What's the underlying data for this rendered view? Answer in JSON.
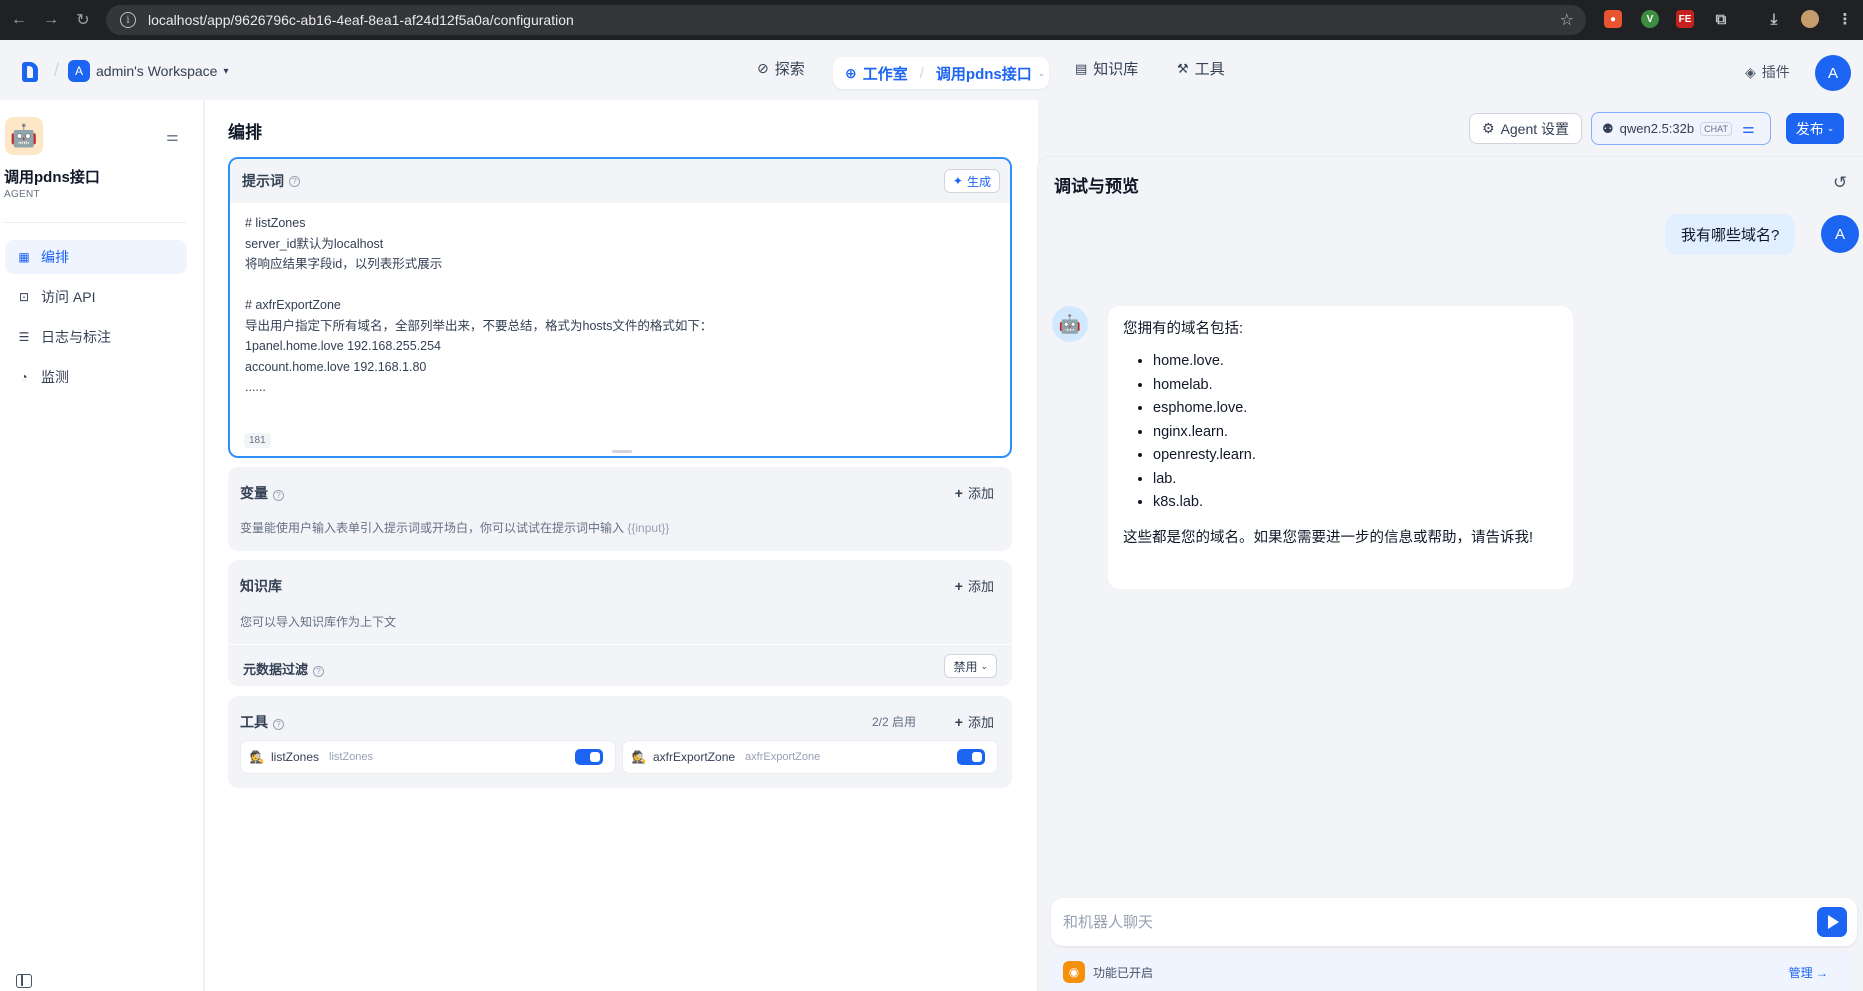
{
  "browser": {
    "url": "localhost/app/9626796c-ab16-4eaf-8ea1-af24d12f5a0a/configuration"
  },
  "header": {
    "workspace_initial": "A",
    "workspace_name": "admin's Workspace",
    "nav_explore": "探索",
    "nav_studio": "工作室",
    "nav_current_app": "调用pdns接口",
    "nav_knowledge": "知识库",
    "nav_tools": "工具",
    "plugins": "插件",
    "user_initial": "A"
  },
  "sidebar": {
    "app_name": "调用pdns接口",
    "app_type": "AGENT",
    "items": [
      {
        "label": "编排"
      },
      {
        "label": "访问 API"
      },
      {
        "label": "日志与标注"
      },
      {
        "label": "监测"
      }
    ]
  },
  "main": {
    "title": "编排",
    "prompt": {
      "title": "提示词",
      "generate_label": "生成",
      "lines": [
        "# listZones",
        "server_id默认为localhost",
        "将响应结果字段id，以列表形式展示",
        "",
        "# axfrExportZone",
        "导出用户指定下所有域名，全部列举出来，不要总结，格式为hosts文件的格式如下：",
        "1panel.home.love 192.168.255.254",
        "account.home.love 192.168.1.80",
        "......"
      ],
      "char_count": "181"
    },
    "variables": {
      "title": "变量",
      "add_label": "添加",
      "desc": "变量能使用户输入表单引入提示词或开场白，你可以试试在提示词中输入",
      "desc_code": "{{input}}"
    },
    "knowledge": {
      "title": "知识库",
      "add_label": "添加",
      "desc": "您可以导入知识库作为上下文",
      "metadata_filter": "元数据过滤",
      "metadata_value": "禁用"
    },
    "tools": {
      "title": "工具",
      "count": "2/2 启用",
      "add_label": "添加",
      "items": [
        {
          "name": "listZones",
          "sub": "listZones"
        },
        {
          "name": "axfrExportZone",
          "sub": "axfrExportZone"
        }
      ]
    }
  },
  "toolbar": {
    "agent_settings": "Agent 设置",
    "model_name": "qwen2.5:32b",
    "model_tag": "CHAT",
    "publish": "发布"
  },
  "debug": {
    "title": "调试与预览",
    "user_message": "我有哪些域名?",
    "user_initial": "A",
    "bot_intro": "您拥有的域名包括:",
    "bot_domains": [
      "home.love.",
      "homelab.",
      "esphome.love.",
      "nginx.learn.",
      "openresty.learn.",
      "lab.",
      "k8s.lab."
    ],
    "bot_outro": "这些都是您的域名。如果您需要进一步的信息或帮助，请告诉我!",
    "input_placeholder": "和机器人聊天",
    "feature_text": "功能已开启",
    "manage_label": "管理"
  },
  "colors": {
    "primary": "#1c64f2",
    "active_bg": "#eff4ff",
    "panel_bg": "#f2f4f7"
  }
}
